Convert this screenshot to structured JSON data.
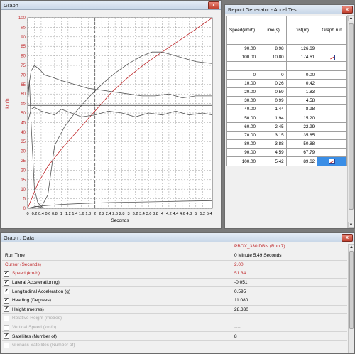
{
  "graph_window": {
    "title": "Graph",
    "close_label": "x"
  },
  "chart_data": {
    "type": "line",
    "xlabel": "Seconds",
    "ylabel": "km/h",
    "xlim": [
      0,
      5.49
    ],
    "ylim": [
      0,
      100
    ],
    "x_ticks": [
      "0",
      "0.2",
      "0.4",
      "0.6",
      "0.8",
      "1",
      "1.2",
      "1.4",
      "1.6",
      "1.8",
      "2",
      "2.2",
      "2.4",
      "2.6",
      "2.8",
      "3",
      "3.2",
      "3.4",
      "3.6",
      "3.8",
      "4",
      "4.2",
      "4.4",
      "4.6",
      "4.8",
      "5",
      "5.2",
      "5.4"
    ],
    "y_ticks": [
      0,
      5,
      10,
      15,
      20,
      25,
      30,
      35,
      40,
      45,
      50,
      55,
      60,
      65,
      70,
      75,
      80,
      85,
      90,
      95,
      100
    ],
    "cursor_x": 2.0,
    "cursor_y": 54,
    "grid": true,
    "series": [
      {
        "color": "#c0282b",
        "x": [
          0,
          0.3,
          0.6,
          1,
          1.5,
          2,
          2.5,
          3,
          3.5,
          4,
          4.5,
          5,
          5.49
        ],
        "y": [
          0,
          13,
          22,
          31,
          41,
          51,
          61,
          69,
          76,
          82,
          88,
          94,
          100
        ]
      },
      {
        "color": "#555555",
        "x": [
          0,
          0.25,
          0.4,
          0.6,
          0.8,
          1.1,
          1.4,
          1.8,
          2.2,
          2.6,
          3,
          3.4,
          3.7,
          4,
          4.4,
          5,
          5.49
        ],
        "y": [
          0,
          1,
          0.5,
          7,
          33,
          43,
          50,
          58,
          65,
          71,
          76,
          80,
          82,
          82,
          80,
          77,
          76
        ]
      },
      {
        "color": "#555555",
        "x": [
          0,
          0.1,
          0.2,
          0.35,
          0.5,
          0.7,
          1,
          1.4,
          1.8,
          2.2,
          2.6,
          3,
          3.4,
          3.8,
          4.2,
          4.6,
          5,
          5.49
        ],
        "y": [
          60,
          72,
          75,
          73,
          70,
          69,
          67,
          65,
          63,
          62,
          61,
          60,
          59,
          59,
          60,
          58,
          59,
          59
        ]
      },
      {
        "color": "#555555",
        "x": [
          0,
          0.1,
          0.2,
          0.4,
          0.6,
          0.8,
          1,
          1.3,
          1.6,
          2,
          2.4,
          2.8,
          3.2,
          3.6,
          4,
          4.4,
          4.8,
          5.2,
          5.49
        ],
        "y": [
          45,
          52,
          53,
          51,
          50,
          49,
          52,
          50,
          48,
          49,
          51,
          50,
          48,
          50,
          49,
          51,
          49,
          50,
          49
        ]
      },
      {
        "color": "#555555",
        "x": [
          0,
          0.05,
          0.1,
          0.2,
          0.3,
          0.4,
          0.5
        ],
        "y": [
          55,
          67,
          45,
          10,
          3,
          1,
          0
        ]
      },
      {
        "color": "#555555",
        "x": [
          0,
          0.3,
          0.6,
          1,
          1.6,
          2.4,
          3.2,
          4,
          4.8,
          5.49
        ],
        "y": [
          0,
          1,
          1.5,
          2,
          2.5,
          3,
          3.2,
          3.5,
          3.8,
          4
        ]
      }
    ]
  },
  "report_window": {
    "title": "Report Generator - Accel Test",
    "columns": [
      "Speed(km/h)",
      "Time(s)",
      "Dist(m)",
      "Graph run"
    ],
    "rows": [
      [
        "90.00",
        "8.98",
        "126.69",
        ""
      ],
      [
        "100.00",
        "10.80",
        "174.61",
        "icon"
      ],
      [
        "",
        "",
        "",
        ""
      ],
      [
        "0",
        "0",
        "0.00",
        ""
      ],
      [
        "10.00",
        "0.26",
        "0.42",
        ""
      ],
      [
        "20.00",
        "0.59",
        "1.83",
        ""
      ],
      [
        "30.00",
        "0.99",
        "4.58",
        ""
      ],
      [
        "40.00",
        "1.44",
        "8.98",
        ""
      ],
      [
        "50.00",
        "1.94",
        "15.20",
        ""
      ],
      [
        "60.00",
        "2.45",
        "22.99",
        ""
      ],
      [
        "70.00",
        "3.15",
        "35.85",
        ""
      ],
      [
        "80.00",
        "3.88",
        "50.88",
        ""
      ],
      [
        "90.00",
        "4.59",
        "67.79",
        ""
      ],
      [
        "100.00",
        "5.42",
        "89.62",
        "icon-selected"
      ]
    ]
  },
  "data_window": {
    "title": "Graph : Data",
    "file_name": "PBOX_330.DBN (Run 7)",
    "rows": [
      {
        "label": "Run Time",
        "value": "0 Minute 5.49 Seconds",
        "checkbox": false,
        "style": "normal"
      },
      {
        "label": "Cursor (Seconds)",
        "value": "2.00",
        "checkbox": false,
        "style": "red"
      },
      {
        "label": "Speed (km/h)",
        "value": "51.34",
        "checkbox": true,
        "style": "red"
      },
      {
        "label": "Lateral Acceleration (g)",
        "value": "-0.051",
        "checkbox": true,
        "style": "normal"
      },
      {
        "label": "Longitudinal Acceleration (g)",
        "value": "0.595",
        "checkbox": true,
        "style": "normal"
      },
      {
        "label": "Heading (Degrees)",
        "value": "11.080",
        "checkbox": true,
        "style": "normal"
      },
      {
        "label": "Height (metres)",
        "value": "28.330",
        "checkbox": true,
        "style": "normal"
      },
      {
        "label": "Relative Height (metres)",
        "value": "----",
        "checkbox": true,
        "style": "gray"
      },
      {
        "label": "Vertical Speed (km/h)",
        "value": "----",
        "checkbox": true,
        "style": "gray"
      },
      {
        "label": "Satellites (Number of)",
        "value": "8",
        "checkbox": true,
        "style": "normal"
      },
      {
        "label": "Glonass Satellites (Number of)",
        "value": "----",
        "checkbox": true,
        "style": "gray"
      }
    ]
  }
}
